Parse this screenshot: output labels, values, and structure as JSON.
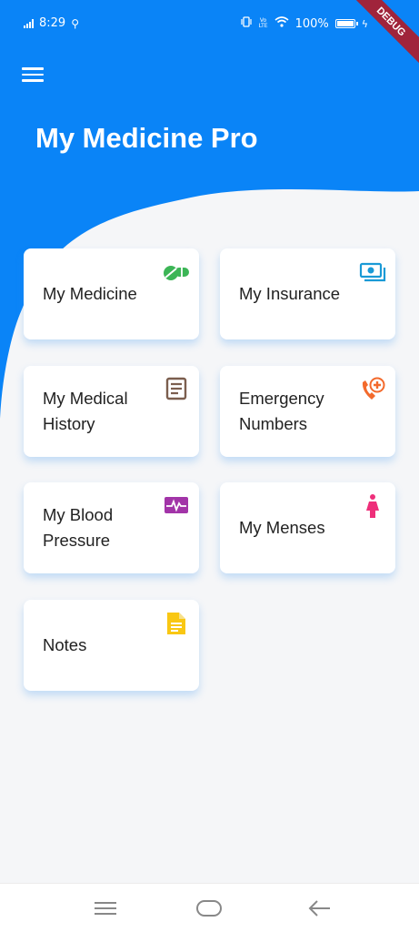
{
  "status_bar": {
    "time": "8:29",
    "lte_label": "LTE",
    "battery": "100%",
    "icons": [
      "signal-icon",
      "usb-icon",
      "vibrate-icon",
      "lte-icon",
      "wifi-icon",
      "battery-icon",
      "charging-icon"
    ]
  },
  "debug_banner": "DEBUG",
  "app_bar": {
    "title": "My Medicine Pro",
    "color": "#0a84f7",
    "menu_icon": "hamburger-menu-icon"
  },
  "cards": [
    {
      "label": "My Medicine",
      "icon": "pills-icon",
      "icon_color": "#3cb556"
    },
    {
      "label": "My Insurance",
      "icon": "money-card-icon",
      "icon_color": "#1a9ad6"
    },
    {
      "label": "My Medical History",
      "icon": "document-list-icon",
      "icon_color": "#7b5e4e"
    },
    {
      "label": "Emergency Numbers",
      "icon": "emergency-phone-icon",
      "icon_color": "#f36a2c"
    },
    {
      "label": "My Blood Pressure",
      "icon": "heart-monitor-icon",
      "icon_color": "#a234a8"
    },
    {
      "label": "My Menses",
      "icon": "female-icon",
      "icon_color": "#ee2f7a"
    },
    {
      "label": "Notes",
      "icon": "note-icon",
      "icon_color": "#f9c713"
    }
  ],
  "nav_bar": {
    "buttons": [
      "recent-apps-icon",
      "home-icon",
      "back-icon"
    ]
  }
}
